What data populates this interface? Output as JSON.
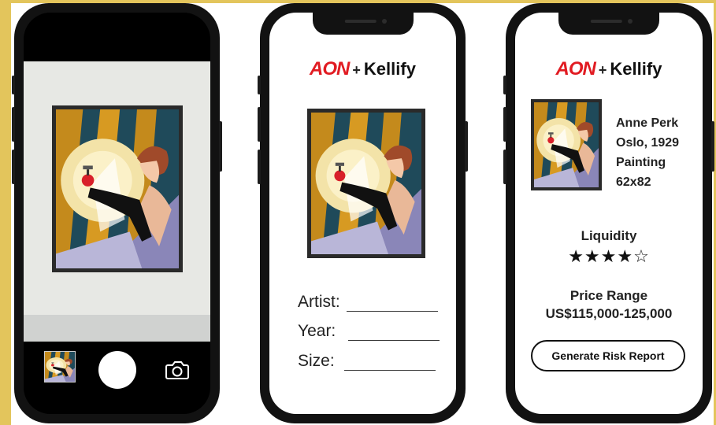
{
  "logo": {
    "aon": "AON",
    "plus": "+",
    "partner": "Kellify"
  },
  "form": {
    "artist_label": "Artist:",
    "year_label": "Year:",
    "size_label": "Size:"
  },
  "result": {
    "artist": "Anne Perk",
    "origin": "Oslo, 1929",
    "medium": "Painting",
    "dimensions": "62x82",
    "liquidity_label": "Liquidity",
    "liquidity_rating": 4,
    "liquidity_max": 5,
    "stars_text": "★★★★☆",
    "price_label": "Price Range",
    "price_value": "US$115,000-125,000",
    "report_button": "Generate Risk Report"
  },
  "icons": [
    "camera-icon",
    "shutter-button",
    "gallery-thumbnail"
  ],
  "colors": {
    "accent_border": "#e3c55c",
    "aon_red": "#e11b22"
  }
}
